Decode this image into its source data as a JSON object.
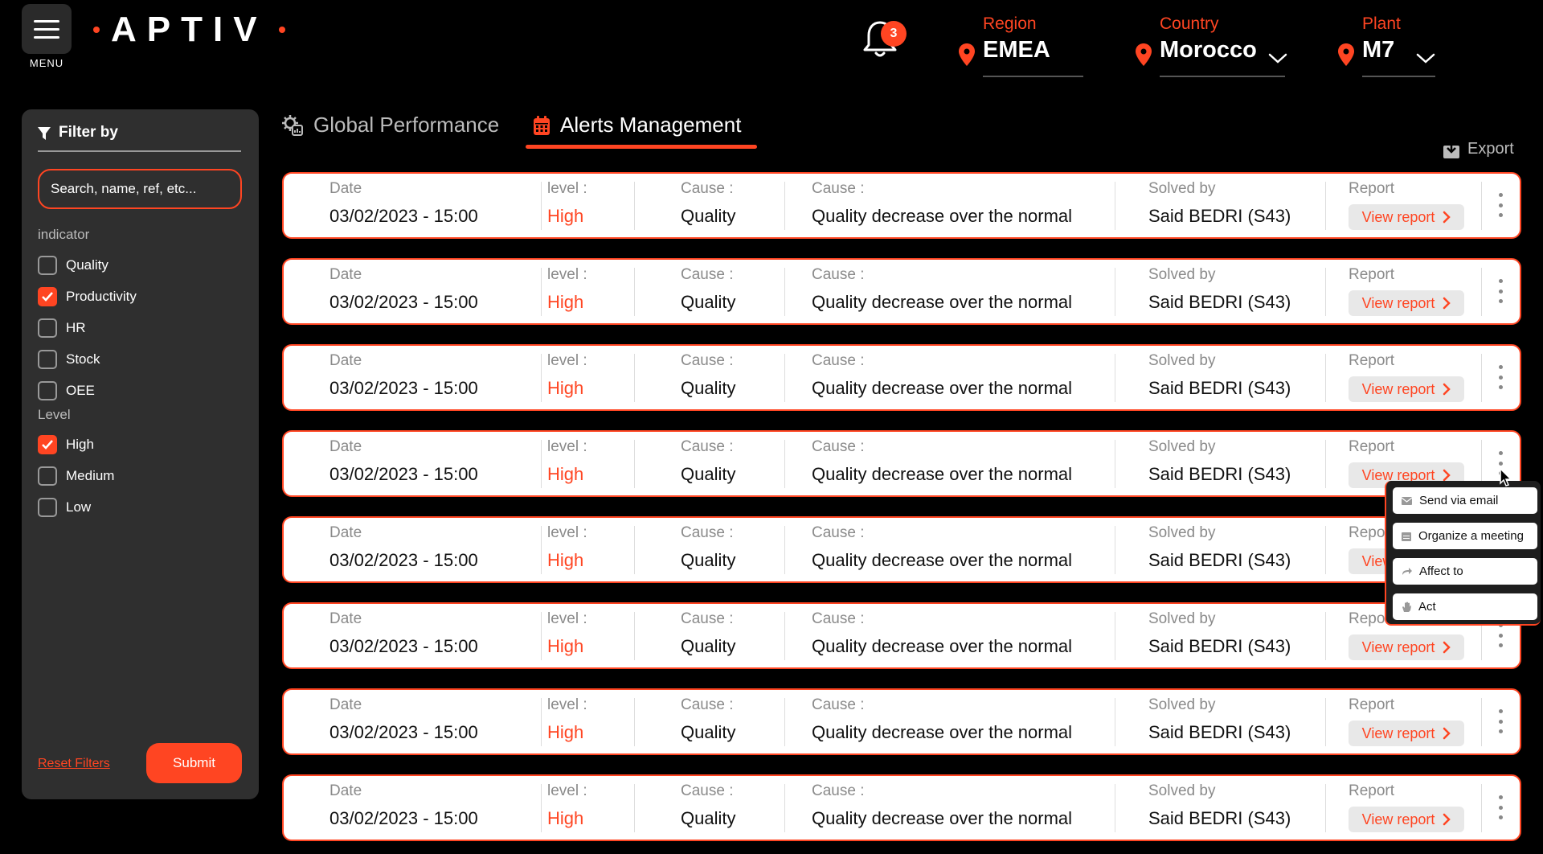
{
  "header": {
    "menu_label": "MENU",
    "logo_text": "APTIV",
    "notification_count": "3",
    "region": {
      "label": "Region",
      "value": "EMEA"
    },
    "country": {
      "label": "Country",
      "value": "Morocco"
    },
    "plant": {
      "label": "Plant",
      "value": "M7"
    }
  },
  "sidebar": {
    "filter_title": "Filter by",
    "search_placeholder": "Search, name, ref, etc...",
    "indicator_label": "indicator",
    "indicators": [
      {
        "label": "Quality",
        "checked": false
      },
      {
        "label": "Productivity",
        "checked": true
      },
      {
        "label": "HR",
        "checked": false
      },
      {
        "label": "Stock",
        "checked": false
      },
      {
        "label": "OEE",
        "checked": false
      }
    ],
    "level_label": "Level",
    "levels": [
      {
        "label": "High",
        "checked": true
      },
      {
        "label": "Medium",
        "checked": false
      },
      {
        "label": "Low",
        "checked": false
      }
    ],
    "reset_label": "Reset Filters",
    "submit_label": "Submit"
  },
  "tabs": [
    {
      "label": "Global Performance",
      "active": false
    },
    {
      "label": "Alerts Management",
      "active": true
    }
  ],
  "export_label": "Export",
  "columns": {
    "date": "Date",
    "level": "level :",
    "cause": "Cause :",
    "cause_detail": "Cause :",
    "solved_by": "Solved by",
    "report": "Report"
  },
  "view_report_label": "View report",
  "alerts": [
    {
      "date": "03/02/2023 - 15:00",
      "level": "High",
      "cause": "Quality",
      "detail": "Quality decrease over the normal",
      "solved_by": "Said BEDRI (S43)"
    },
    {
      "date": "03/02/2023 - 15:00",
      "level": "High",
      "cause": "Quality",
      "detail": "Quality decrease over the normal",
      "solved_by": "Said BEDRI (S43)"
    },
    {
      "date": "03/02/2023 - 15:00",
      "level": "High",
      "cause": "Quality",
      "detail": "Quality decrease over the normal",
      "solved_by": "Said BEDRI (S43)"
    },
    {
      "date": "03/02/2023 - 15:00",
      "level": "High",
      "cause": "Quality",
      "detail": "Quality decrease over the normal",
      "solved_by": "Said BEDRI (S43)"
    },
    {
      "date": "03/02/2023 - 15:00",
      "level": "High",
      "cause": "Quality",
      "detail": "Quality decrease over the normal",
      "solved_by": "Said BEDRI (S43)"
    },
    {
      "date": "03/02/2023 - 15:00",
      "level": "High",
      "cause": "Quality",
      "detail": "Quality decrease over the normal",
      "solved_by": "Said BEDRI (S43)"
    },
    {
      "date": "03/02/2023 - 15:00",
      "level": "High",
      "cause": "Quality",
      "detail": "Quality decrease over the normal",
      "solved_by": "Said BEDRI (S43)"
    },
    {
      "date": "03/02/2023 - 15:00",
      "level": "High",
      "cause": "Quality",
      "detail": "Quality decrease over the normal",
      "solved_by": "Said BEDRI (S43)"
    }
  ],
  "context_menu": [
    {
      "label": "Send via email",
      "icon": "mail-icon"
    },
    {
      "label": "Organize a meeting",
      "icon": "calendar-icon"
    },
    {
      "label": "Affect to",
      "icon": "share-arrow-icon"
    },
    {
      "label": "Act",
      "icon": "hand-icon"
    }
  ],
  "colors": {
    "accent": "#ff4522",
    "background": "#000000",
    "panel": "#2f2f2f"
  }
}
